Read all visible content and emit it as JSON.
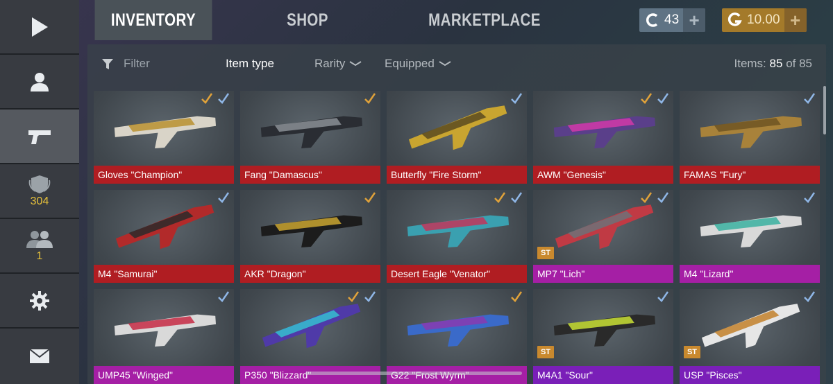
{
  "sidebar": {
    "items": [
      {
        "name": "play-icon"
      },
      {
        "name": "profile-icon"
      },
      {
        "name": "pistol-icon"
      },
      {
        "name": "rank-shield-icon",
        "count": "304"
      },
      {
        "name": "friends-icon",
        "count": "1"
      },
      {
        "name": "gear-icon"
      },
      {
        "name": "mail-icon"
      }
    ]
  },
  "tabs": [
    {
      "label": "INVENTORY",
      "active": true
    },
    {
      "label": "SHOP",
      "active": false
    },
    {
      "label": "MARKETPLACE",
      "active": false
    }
  ],
  "currency": {
    "credits": "43",
    "gold": "10.00",
    "credit_color": "#5f7384",
    "gold_color": "#a47a2a"
  },
  "filterbar": {
    "filter": "Filter",
    "item_type": "Item type",
    "rarity": "Rarity",
    "equipped": "Equipped",
    "items_label": "Items:",
    "items_count": "85",
    "items_of": "of 85"
  },
  "items": [
    {
      "name": "Gloves \"Champion\"",
      "rarity": "#b01d22",
      "orange_check": true,
      "blue_check": true,
      "st": false
    },
    {
      "name": "Fang \"Damascus\"",
      "rarity": "#b01d22",
      "orange_check": true,
      "blue_check": false,
      "st": false
    },
    {
      "name": "Butterfly \"Fire Storm\"",
      "rarity": "#b01d22",
      "orange_check": false,
      "blue_check": true,
      "st": false
    },
    {
      "name": "AWM \"Genesis\"",
      "rarity": "#b01d22",
      "orange_check": true,
      "blue_check": true,
      "st": false
    },
    {
      "name": "FAMAS \"Fury\"",
      "rarity": "#b01d22",
      "orange_check": false,
      "blue_check": true,
      "st": false
    },
    {
      "name": "M4 \"Samurai\"",
      "rarity": "#b01d22",
      "orange_check": false,
      "blue_check": true,
      "st": false
    },
    {
      "name": "AKR \"Dragon\"",
      "rarity": "#b01d22",
      "orange_check": true,
      "blue_check": false,
      "st": false
    },
    {
      "name": "Desert Eagle \"Venator\"",
      "rarity": "#b01d22",
      "orange_check": true,
      "blue_check": true,
      "st": false
    },
    {
      "name": "MP7 \"Lich\"",
      "rarity": "#a51fa5",
      "orange_check": true,
      "blue_check": true,
      "st": true,
      "st_label": "ST"
    },
    {
      "name": "M4 \"Lizard\"",
      "rarity": "#a51fa5",
      "orange_check": false,
      "blue_check": true,
      "st": false
    },
    {
      "name": "UMP45 \"Winged\"",
      "rarity": "#a51fa5",
      "orange_check": false,
      "blue_check": true,
      "st": false
    },
    {
      "name": "P350 \"Blizzard\"",
      "rarity": "#a51fa5",
      "orange_check": true,
      "blue_check": true,
      "st": false
    },
    {
      "name": "G22 \"Frost Wyrm\"",
      "rarity": "#a51fa5",
      "orange_check": true,
      "blue_check": false,
      "st": false
    },
    {
      "name": "M4A1 \"Sour\"",
      "rarity": "#7a1fb8",
      "orange_check": false,
      "blue_check": true,
      "st": true,
      "st_label": "ST"
    },
    {
      "name": "USP \"Pisces\"",
      "rarity": "#7a1fb8",
      "orange_check": false,
      "blue_check": true,
      "st": true,
      "st_label": "ST"
    }
  ]
}
